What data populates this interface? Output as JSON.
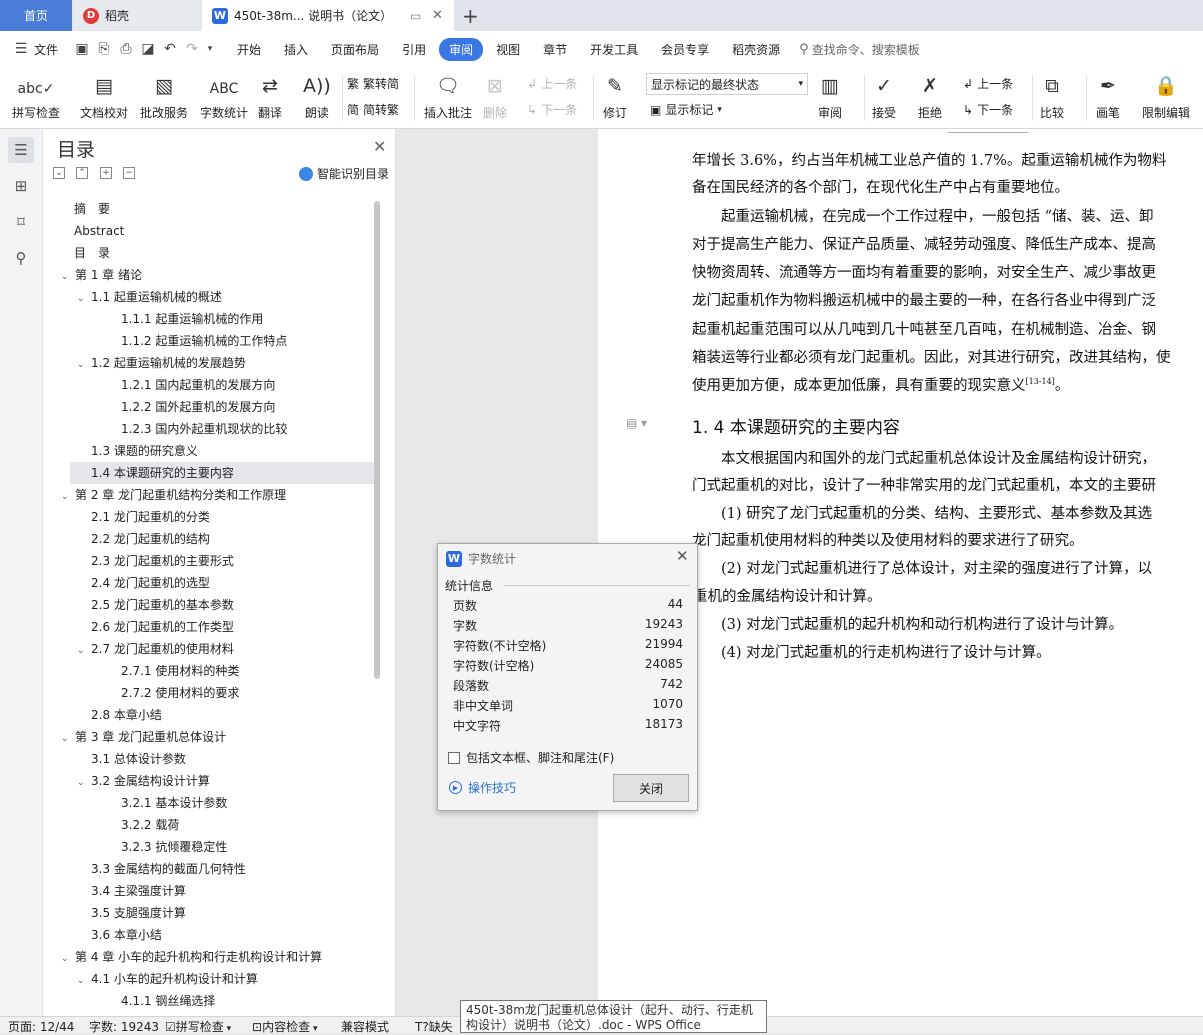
{
  "tabs": {
    "home": "首页",
    "daoke": "稻壳",
    "doc": "450t-38m... 说明书（论文）"
  },
  "menu": [
    "文件",
    "开始",
    "插入",
    "页面布局",
    "引用",
    "审阅",
    "视图",
    "章节",
    "开发工具",
    "会员专享",
    "稻壳资源"
  ],
  "menu_active": "审阅",
  "search": {
    "label": "查找命令、搜索模板"
  },
  "ribbon": {
    "spell": "拼写检查",
    "proof": "文档校对",
    "batch": "批改服务",
    "wordcount": "字数统计",
    "translate": "翻译",
    "read": "朗读",
    "to_trad": "繁转简",
    "to_simp": "简转繁",
    "insert_comment": "插入批注",
    "delete": "删除",
    "prev": "上一条",
    "next": "下一条",
    "revise": "修订",
    "show_final": "显示标记的最终状态",
    "show_marks": "显示标记",
    "review": "审阅",
    "accept": "接受",
    "reject": "拒绝",
    "prev2": "上一条",
    "next2": "下一条",
    "compare": "比较",
    "pen": "画笔",
    "restrict": "限制编辑"
  },
  "toc": {
    "title": "目录",
    "smart": "智能识别目录",
    "items": [
      {
        "label": "摘　要"
      },
      {
        "label": "Abstract"
      },
      {
        "label": "目　录"
      },
      {
        "label": "第 1 章  绪论"
      },
      {
        "label": "1.1 起重运输机械的概述"
      },
      {
        "label": "1.1.1 起重运输机械的作用"
      },
      {
        "label": "1.1.2 起重运输机械的工作特点"
      },
      {
        "label": "1.2 起重运输机械的发展趋势"
      },
      {
        "label": "1.2.1 国内起重机的发展方向"
      },
      {
        "label": "1.2.2 国外起重机的发展方向"
      },
      {
        "label": "1.2.3 国内外起重机现状的比较"
      },
      {
        "label": "1.3 课题的研究意义"
      },
      {
        "label": "1.4 本课题研究的主要内容"
      },
      {
        "label": "第 2 章  龙门起重机结构分类和工作原理"
      },
      {
        "label": "2.1 龙门起重机的分类"
      },
      {
        "label": "2.2 龙门起重机的结构"
      },
      {
        "label": "2.3 龙门起重机的主要形式"
      },
      {
        "label": "2.4 龙门起重机的选型"
      },
      {
        "label": "2.5 龙门起重机的基本参数"
      },
      {
        "label": "2.6 龙门起重机的工作类型"
      },
      {
        "label": "2.7 龙门起重机的使用材料"
      },
      {
        "label": "2.7.1 使用材料的种类"
      },
      {
        "label": "2.7.2 使用材料的要求"
      },
      {
        "label": "2.8 本章小结"
      },
      {
        "label": "第 3 章  龙门起重机总体设计"
      },
      {
        "label": "3.1 总体设计参数"
      },
      {
        "label": "3.2 金属结构设计计算"
      },
      {
        "label": "3.2.1 基本设计参数"
      },
      {
        "label": "3.2.2 载荷"
      },
      {
        "label": "3.2.3 抗倾覆稳定性"
      },
      {
        "label": "3.3 金属结构的截面几何特性"
      },
      {
        "label": "3.4 主梁强度计算"
      },
      {
        "label": "3.5 支腿强度计算"
      },
      {
        "label": "3.6 本章小结"
      },
      {
        "label": "第 4 章  小车的起升机构和行走机构设计和计算"
      },
      {
        "label": "4.1 小车的起升机构设计和计算"
      },
      {
        "label": "4.1.1 钢丝绳选择"
      }
    ]
  },
  "doc": {
    "lines": [
      "年增长 3.6%，约占当年机械工业总产值的 1.7%。起重运输机械作为物料",
      "备在国民经济的各个部门，在现代化生产中占有重要地位。",
      "起重运输机械，在完成一个工作过程中，一般包括 “储、装、运、卸",
      "对于提高生产能力、保证产品质量、减轻劳动强度、降低生产成本、提高",
      "快物资周转、流通等方一面均有着重要的影响，对安全生产、减少事故更",
      "龙门起重机作为物料搬运机械中的最主要的一种，在各行各业中得到广泛",
      "起重机起重范围可以从几吨到几十吨甚至几百吨，在机械制造、冶金、钢",
      "箱装运等行业都必须有龙门起重机。因此，对其进行研究，改进其结构，使",
      "使用更加方便，成本更加低廉，具有重要的现实意义"
    ],
    "cite": "[13-14]",
    "end": "。",
    "heading": "1. 4 本课题研究的主要内容",
    "lines2": [
      "本文根据国内和国外的龙门式起重机总体设计及金属结构设计研究，",
      "门式起重机的对比，设计了一种非常实用的龙门式起重机，本文的主要研",
      "(1) 研究了龙门式起重机的分类、结构、主要形式、基本参数及其选",
      "龙门起重机使用材料的种类以及使用材料的要求进行了研究。",
      "(2) 对龙门式起重机进行了总体设计，对主梁的强度进行了计算，以",
      "重机的金属结构设计和计算。",
      "(3) 对龙门式起重机的起升机构和动行机构进行了设计与计算。",
      "(4) 对龙门式起重机的行走机构进行了设计与计算。"
    ]
  },
  "dialog": {
    "title": "字数统计",
    "section": "统计信息",
    "stats": [
      {
        "label": "页数",
        "value": "44"
      },
      {
        "label": "字数",
        "value": "19243"
      },
      {
        "label": "字符数(不计空格)",
        "value": "21994"
      },
      {
        "label": "字符数(计空格)",
        "value": "24085"
      },
      {
        "label": "段落数",
        "value": "742"
      },
      {
        "label": "非中文单词",
        "value": "1070"
      },
      {
        "label": "中文字符",
        "value": "18173"
      }
    ],
    "checkbox": "包括文本框、脚注和尾注(F)",
    "tips": "操作技巧",
    "close": "关闭"
  },
  "status": {
    "page": "页面: 12/44",
    "words": "字数: 19243",
    "spell": "拼写检查",
    "content": "内容检查",
    "compat": "兼容模式",
    "missing": "缺失"
  },
  "tooltip": "450t-38m龙门起重机总体设计（起升、动行、行走机构设计）说明书（论文）.doc - WPS Office",
  "colors": {
    "accent": "#3a76e4",
    "home_tab": "#4a7dd8"
  }
}
